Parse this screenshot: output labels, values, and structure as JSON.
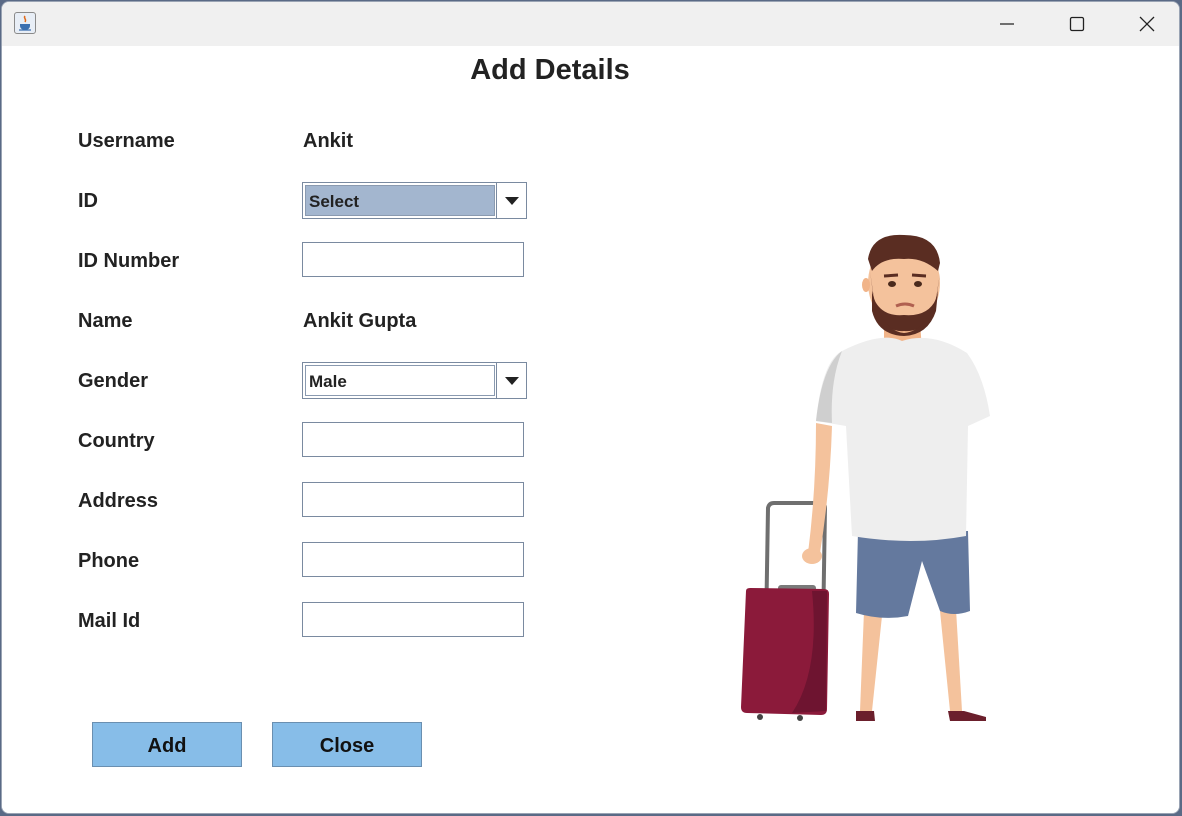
{
  "window": {
    "app_icon": "java-icon",
    "controls": [
      "minimize-icon",
      "maximize-icon",
      "close-icon"
    ]
  },
  "title": "Add Details",
  "form": {
    "username": {
      "label": "Username",
      "value": "Ankit"
    },
    "id": {
      "label": "ID",
      "selected": "Select"
    },
    "id_number": {
      "label": "ID Number",
      "value": ""
    },
    "name": {
      "label": "Name",
      "value": "Ankit Gupta"
    },
    "gender": {
      "label": "Gender",
      "selected": "Male"
    },
    "country": {
      "label": "Country",
      "value": ""
    },
    "address": {
      "label": "Address",
      "value": ""
    },
    "phone": {
      "label": "Phone",
      "value": ""
    },
    "mail": {
      "label": "Mail Id",
      "value": ""
    }
  },
  "buttons": {
    "add": "Add",
    "close": "Close"
  },
  "colors": {
    "button_bg": "#87bde8",
    "combo_selected_bg": "#a3b6cf",
    "suitcase": "#8b1a3a",
    "shirt": "#eeeeee",
    "shorts": "#64799e"
  }
}
